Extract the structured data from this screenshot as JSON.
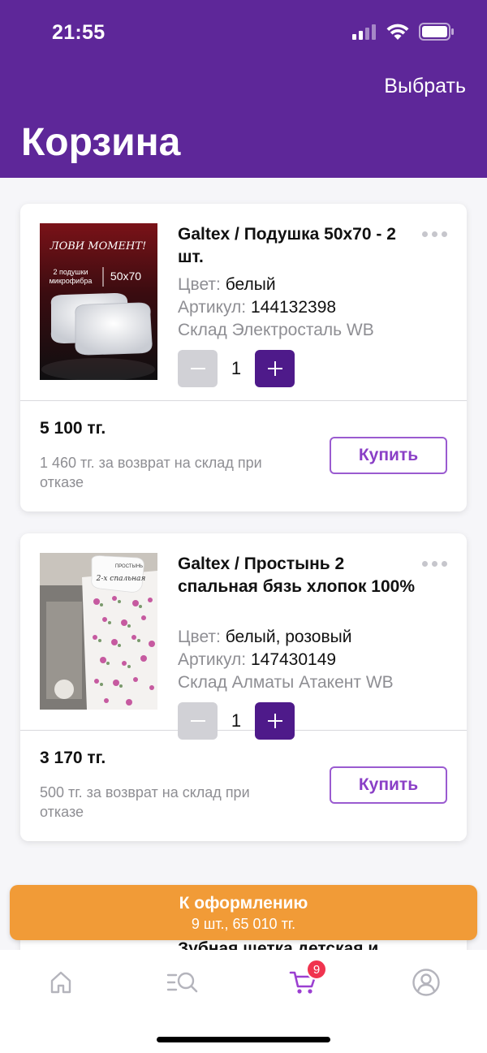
{
  "status_bar": {
    "time": "21:55"
  },
  "header": {
    "select_label": "Выбрать",
    "title": "Корзина"
  },
  "cart": {
    "items": [
      {
        "name": "Galtex / Подушка 50х70 - 2 шт.",
        "color_key": "Цвет:",
        "color_val": "белый",
        "article_key": "Артикул:",
        "article_val": "144132398",
        "warehouse": "Склад Электросталь WB",
        "qty": "1",
        "price": "5 100 тг.",
        "return_note": "1 460 тг. за возврат на склад при отказе",
        "buy_label": "Купить",
        "image_text": {
          "line1": "ЛОВИ МОМЕНТ!",
          "line2": "2 подушки",
          "line3": "микрофибра",
          "size": "50x70"
        }
      },
      {
        "name": "Galtex / Простынь 2 спальная бязь хлопок 100%",
        "color_key": "Цвет:",
        "color_val": "белый, розовый",
        "article_key": "Артикул:",
        "article_val": "147430149",
        "warehouse": "Склад Алматы Атакент WB",
        "qty": "1",
        "price": "3 170 тг.",
        "return_note": "500 тг. за возврат на склад при отказе",
        "buy_label": "Купить",
        "image_text": {
          "line1": "ПРОСТЫНЬ",
          "line2": "2-х спальная"
        }
      }
    ],
    "peek_item_text": "Зубная щетка детская и"
  },
  "checkout": {
    "label": "К оформлению",
    "summary": "9 шт., 65 010 тг."
  },
  "tabbar": {
    "items": [
      {
        "icon": "home-icon",
        "active": false
      },
      {
        "icon": "catalog-search-icon",
        "active": false
      },
      {
        "icon": "cart-icon",
        "active": true
      },
      {
        "icon": "profile-icon",
        "active": false
      }
    ],
    "cart_badge": "9"
  },
  "colors": {
    "brand": "#5e2799",
    "stepper_plus": "#4e1a8a",
    "checkout": "#f19b37",
    "badge": "#f0344f",
    "buy_text": "#8a3fc6"
  }
}
